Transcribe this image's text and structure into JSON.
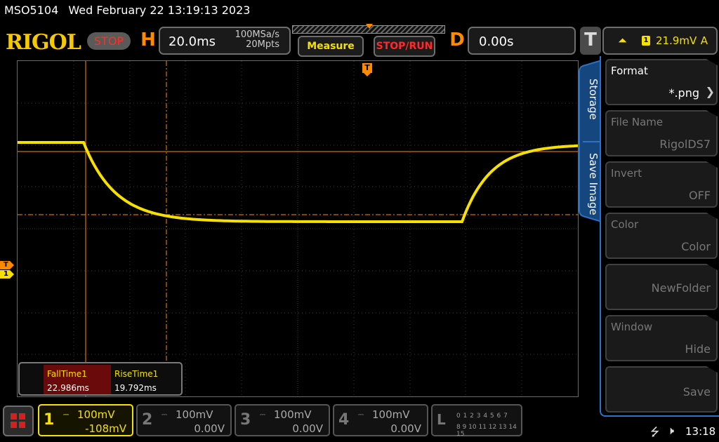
{
  "status": {
    "model": "MSO5104",
    "datetime": "Wed February 22 13:19:13 2023"
  },
  "header": {
    "brand": "RIGOL",
    "run_state": "STOP",
    "horizontal": {
      "letter": "H",
      "timebase": "20.0ms",
      "sample_rate": "100MSa/s",
      "memory_depth": "20Mpts"
    },
    "measure_button": "Measure",
    "stoprun_button": "STOP/RUN",
    "delay": {
      "letter": "D",
      "value": "0.00s"
    },
    "trigger": {
      "letter": "T",
      "edge_icon": "rising-edge-icon",
      "source": "1",
      "level": "21.9mV",
      "mode": "A"
    }
  },
  "screen": {
    "trigger_marker": "T",
    "markers": {
      "trigger_level": "T",
      "channel1": "1"
    },
    "colors": {
      "channel1": "#f5e000",
      "cursor": "#ff8a00",
      "grid": "#3a3a3a"
    }
  },
  "measurements": [
    {
      "name": "FallTime1",
      "value": "22.986ms"
    },
    {
      "name": "RiseTime1",
      "value": "19.792ms"
    }
  ],
  "menu": {
    "tabs": [
      "Storage",
      "Save Image"
    ],
    "items": [
      {
        "label": "Format",
        "value": "*.png",
        "enabled": true
      },
      {
        "label": "File Name",
        "value": "RigolDS7",
        "enabled": false
      },
      {
        "label": "Invert",
        "value": "OFF",
        "enabled": false
      },
      {
        "label": "Color",
        "value": "Color",
        "enabled": false
      },
      {
        "label": "",
        "value": "NewFolder",
        "enabled": false
      },
      {
        "label": "Window",
        "value": "Hide",
        "enabled": false
      },
      {
        "label": "",
        "value": "Save",
        "enabled": false
      }
    ]
  },
  "channels": [
    {
      "num": "1",
      "coupling": "DC",
      "scale": "100mV",
      "offset": "-108mV",
      "active": true
    },
    {
      "num": "2",
      "coupling": "DC",
      "scale": "100mV",
      "offset": "0.00V",
      "active": false
    },
    {
      "num": "3",
      "coupling": "DC",
      "scale": "100mV",
      "offset": "0.00V",
      "active": false
    },
    {
      "num": "4",
      "coupling": "DC",
      "scale": "100mV",
      "offset": "0.00V",
      "active": false
    }
  ],
  "logic": {
    "letter": "L",
    "row1": "0 1 2 3  4 5 6 7",
    "row2": "8 9 10 11 12 13 14 15"
  },
  "system": {
    "usb_icon": "usb-icon",
    "speaker_icon": "speaker-muted-icon",
    "clock": "13:18"
  }
}
